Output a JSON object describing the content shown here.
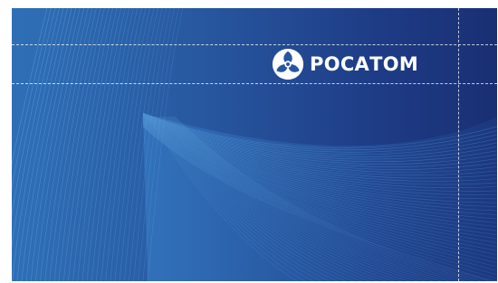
{
  "slide": {
    "brand_text": "РОСАТОМ",
    "logo_icon": "rosatom-atom-logo-icon",
    "colors": {
      "background_left": "#2f6fb6",
      "background_right": "#1a2f74",
      "line_color": "#6fb3ea",
      "logo_color": "#ffffff",
      "guide_color": "#ffffff"
    }
  }
}
